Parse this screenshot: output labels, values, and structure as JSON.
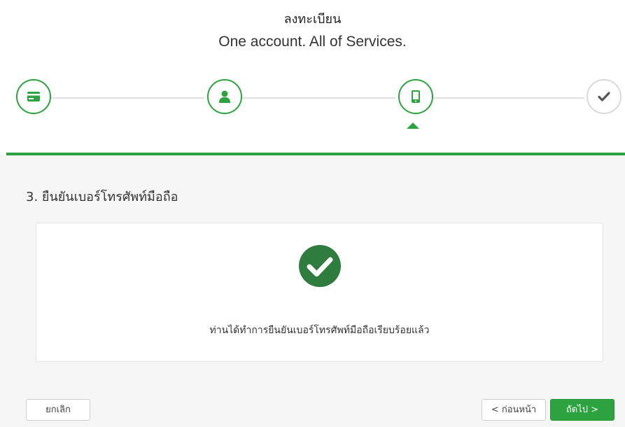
{
  "header": {
    "title": "ลงทะเบียน",
    "subtitle": "One account. All of Services."
  },
  "steps": [
    {
      "icon": "card-icon",
      "status": "complete"
    },
    {
      "icon": "user-icon",
      "status": "complete"
    },
    {
      "icon": "mobile-phone-icon",
      "status": "current"
    },
    {
      "icon": "checkmark-icon",
      "status": "pending"
    }
  ],
  "section": {
    "title": "3. ยืนยันเบอร์โทรศัพท์มือถือ",
    "message": "ท่านได้ทำการยืนยันเบอร์โทรศัพท์มือถือเรียบร้อยแล้ว"
  },
  "buttons": {
    "cancel": "ยกเลิก",
    "previous": "< ก่อนหน้า",
    "next": "ถัดไป >"
  },
  "colors": {
    "accent": "#2ca33f",
    "success_icon": "#2f7d3e",
    "pending": "#d9d9d9"
  }
}
